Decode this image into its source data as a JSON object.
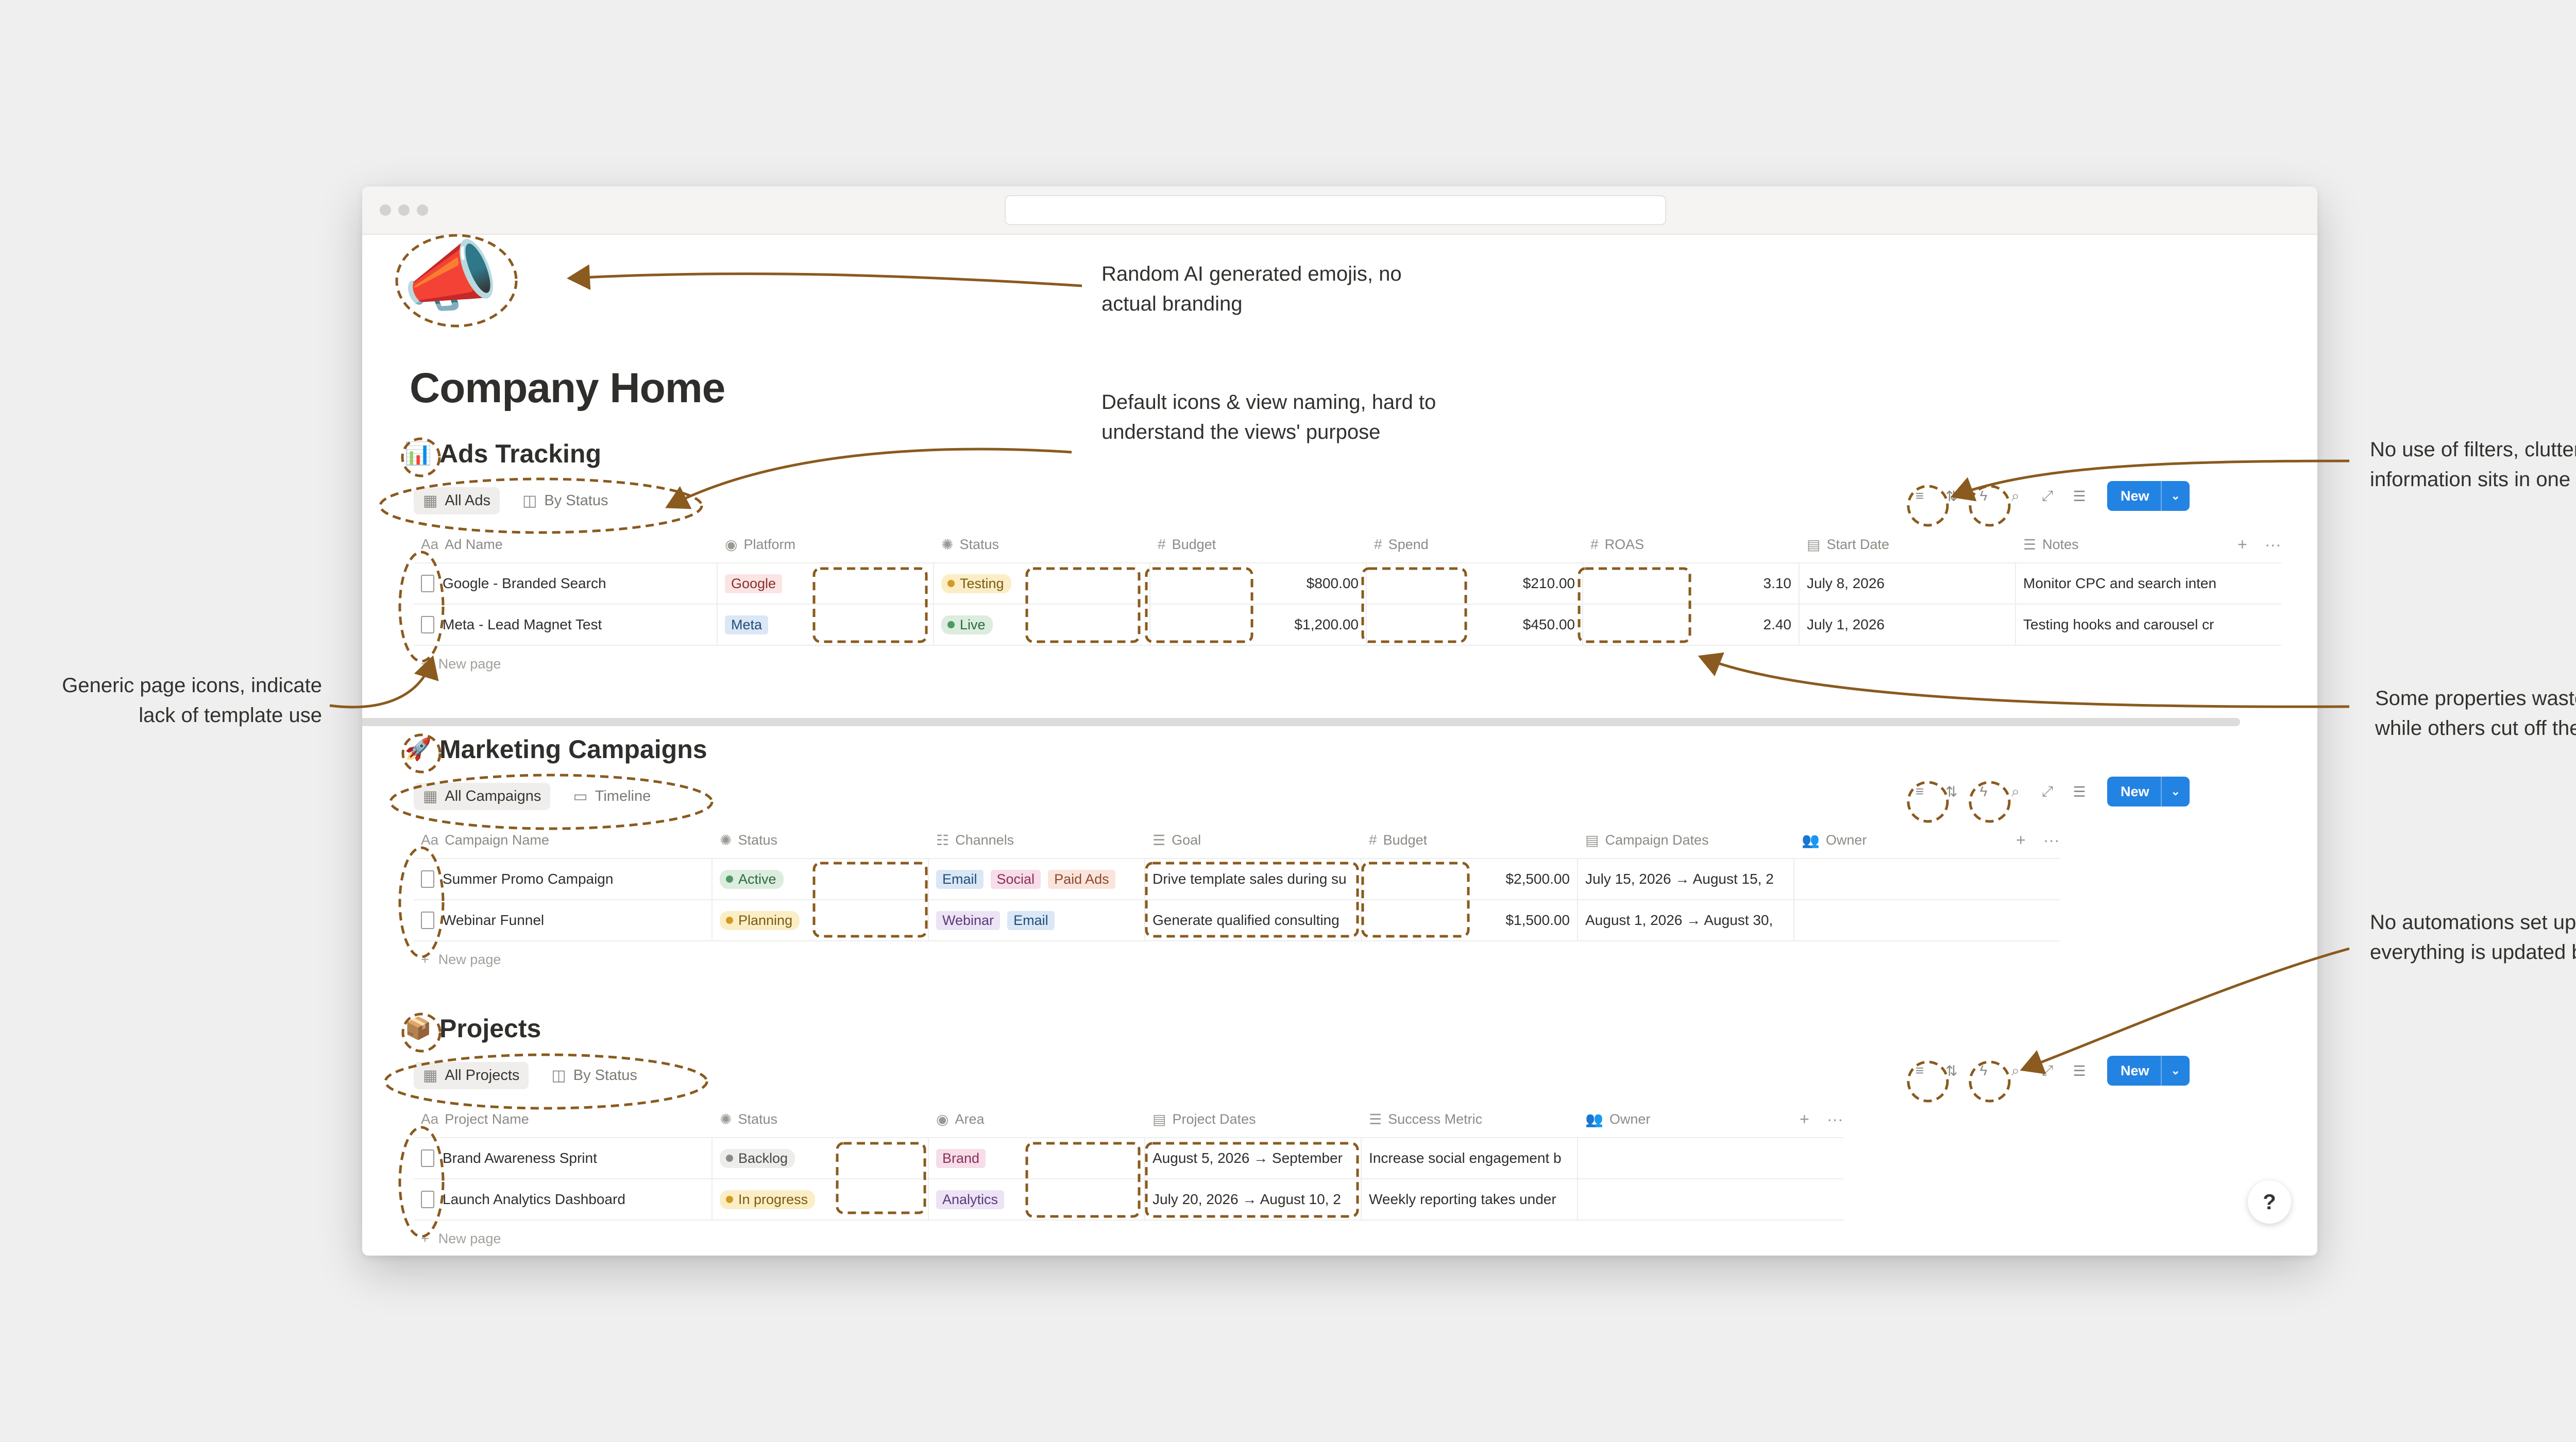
{
  "page": {
    "emoji": "📣",
    "title": "Company Home"
  },
  "ads": {
    "emoji": "📊",
    "title": "Ads Tracking",
    "views": [
      "All Ads",
      "By Status"
    ],
    "columns": [
      "Ad Name",
      "Platform",
      "Status",
      "Budget",
      "Spend",
      "ROAS",
      "Start Date",
      "Notes"
    ],
    "rows": [
      {
        "name": "Google - Branded Search",
        "platform": "Google",
        "status": "Testing",
        "budget": "$800.00",
        "spend": "$210.00",
        "roas": "3.10",
        "start": "July 8, 2026",
        "notes": "Monitor CPC and search inten"
      },
      {
        "name": "Meta - Lead Magnet Test",
        "platform": "Meta",
        "status": "Live",
        "budget": "$1,200.00",
        "spend": "$450.00",
        "roas": "2.40",
        "start": "July 1, 2026",
        "notes": "Testing hooks and carousel cr"
      }
    ],
    "new_page": "New page",
    "new_button": "New"
  },
  "marketing": {
    "emoji": "🚀",
    "title": "Marketing Campaigns",
    "views": [
      "All Campaigns",
      "Timeline"
    ],
    "columns": [
      "Campaign Name",
      "Status",
      "Channels",
      "Goal",
      "Budget",
      "Campaign Dates",
      "Owner"
    ],
    "rows": [
      {
        "name": "Summer Promo Campaign",
        "status": "Active",
        "channels": [
          "Email",
          "Social",
          "Paid Ads"
        ],
        "goal": "Drive template sales during su",
        "budget": "$2,500.00",
        "dates": "July 15, 2026 → August 15, 2"
      },
      {
        "name": "Webinar Funnel",
        "status": "Planning",
        "channels": [
          "Webinar",
          "Email"
        ],
        "goal": "Generate qualified consulting",
        "budget": "$1,500.00",
        "dates": "August 1, 2026 → August 30,"
      }
    ],
    "new_page": "New page",
    "new_button": "New"
  },
  "projects": {
    "emoji": "📦",
    "title": "Projects",
    "views": [
      "All Projects",
      "By Status"
    ],
    "columns": [
      "Project Name",
      "Status",
      "Area",
      "Project Dates",
      "Success Metric",
      "Owner"
    ],
    "rows": [
      {
        "name": "Brand Awareness Sprint",
        "status": "Backlog",
        "area": "Brand",
        "dates": "August 5, 2026 → September",
        "metric": "Increase social engagement b"
      },
      {
        "name": "Launch Analytics Dashboard",
        "status": "In progress",
        "area": "Analytics",
        "dates": "July 20, 2026 → August 10, 2",
        "metric": "Weekly reporting takes under"
      }
    ],
    "new_page": "New page",
    "new_button": "New"
  },
  "annotations": {
    "emoji_l1": "Random AI generated emojis, no",
    "emoji_l2": "actual branding",
    "views_l1": "Default icons & view naming, hard to",
    "views_l2": "understand the views' purpose",
    "filters_l1": "No use of filters, cluttered",
    "filters_l2": "information sits in one view",
    "icons_l1": "Generic page icons, indicate",
    "icons_l2": "lack of template use",
    "props_l1": "Some properties waste space",
    "props_l2": "while others cut off the text",
    "auto_l1": "No automations set up, so",
    "auto_l2": "everything is updated by hand"
  },
  "colors": {
    "accent_blue": "#2383e2",
    "annotation_brown": "#8a5a1e",
    "tag_google": "#fbe4e4",
    "tag_meta": "#dbe7f5",
    "status_testing": "#fbeec6",
    "status_live": "#dcecdf",
    "tag_email": "#dbe7f5",
    "tag_social": "#f6dde8",
    "tag_paid": "#fbe4dc",
    "tag_webinar": "#ece3f5",
    "status_backlog": "#ededec",
    "tag_brand": "#f6dde8",
    "tag_analytics": "#ece3f5"
  },
  "icons": [
    "page-icon",
    "table-icon",
    "board-icon",
    "timeline-icon",
    "filter-icon",
    "sort-icon",
    "lightning-icon",
    "search-icon",
    "expand-icon",
    "settings-icon",
    "plus-icon",
    "more-icon"
  ]
}
